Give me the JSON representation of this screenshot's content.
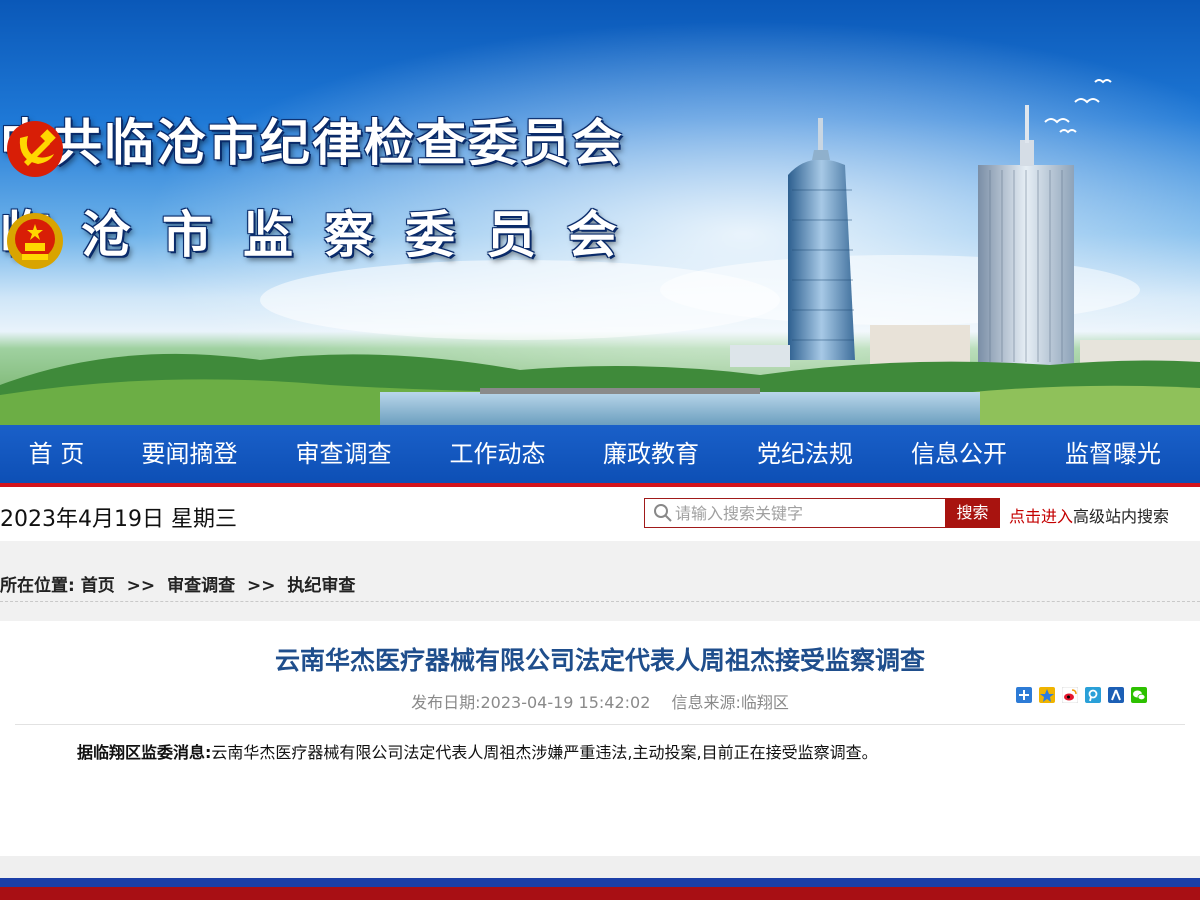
{
  "header": {
    "line1": "中共临沧市纪律检查委员会",
    "line2": "临沧市监察委员会",
    "party_emblem_icon": "party-emblem-icon",
    "national_emblem_icon": "national-emblem-icon"
  },
  "nav": {
    "items": [
      "首 页",
      "要闻摘登",
      "审查调查",
      "工作动态",
      "廉政教育",
      "党纪法规",
      "信息公开",
      "监督曝光"
    ]
  },
  "datebar": {
    "date": "2023年4月19日 星期三",
    "search_placeholder": "请输入搜索关键字",
    "search_button": "搜索",
    "advanced_prefix": "点击进入",
    "advanced_suffix": "高级站内搜索"
  },
  "breadcrumb": {
    "label": "所在位置:",
    "items": [
      "首页",
      "审查调查",
      "执纪审查"
    ],
    "separator": ">>"
  },
  "article": {
    "title": "云南华杰医疗器械有限公司法定代表人周祖杰接受监察调查",
    "date_label": "发布日期:2023-04-19 15:42:02",
    "source_label": "信息来源:临翔区",
    "lead": "据临翔区监委消息:",
    "body": "云南华杰医疗器械有限公司法定代表人周祖杰涉嫌严重违法,主动投案,目前正在接受监察调查。",
    "share_icons": [
      "share-more-icon",
      "share-qzone-icon",
      "share-weibo-icon",
      "share-tencent-weibo-icon",
      "share-renren-icon",
      "share-wechat-icon"
    ]
  },
  "colors": {
    "nav_bg": "#0d4fb5",
    "nav_border": "#d3131b",
    "search_btn": "#a8130f",
    "title_color": "#1f4e8c",
    "footer_blue": "#1b3fa8",
    "footer_red": "#a80f14"
  }
}
